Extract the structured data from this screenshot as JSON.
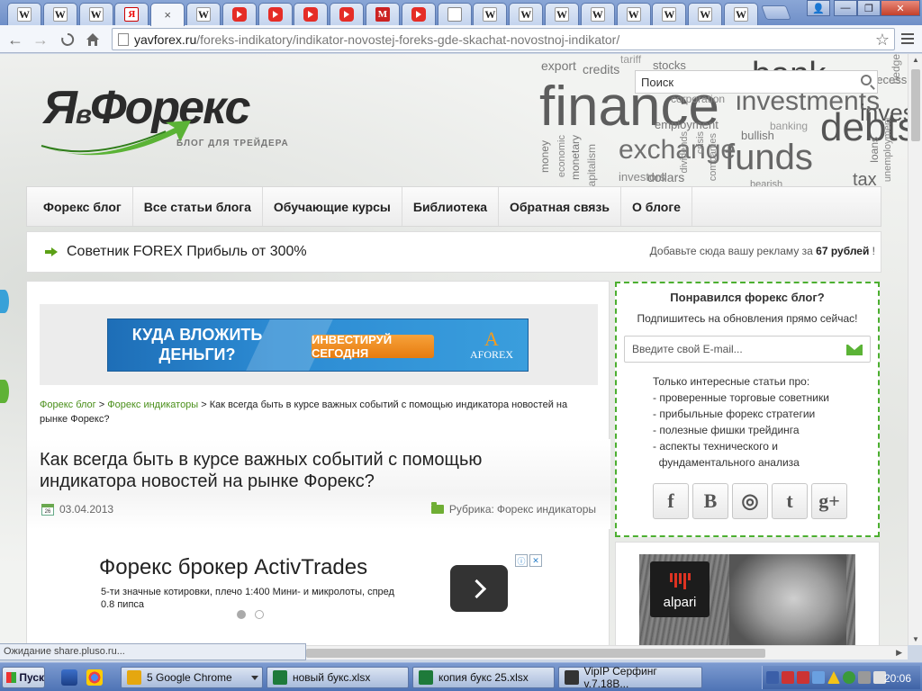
{
  "browser": {
    "tabs": [
      {
        "icon": "wikipedia-icon",
        "glyph": "W",
        "kind": "w"
      },
      {
        "icon": "wikipedia-icon",
        "glyph": "W",
        "kind": "w"
      },
      {
        "icon": "wikipedia-icon",
        "glyph": "W",
        "kind": "w"
      },
      {
        "icon": "yandex-icon",
        "glyph": "Я",
        "kind": "ya"
      },
      {
        "icon": "close-icon",
        "glyph": "×",
        "kind": "active"
      },
      {
        "icon": "wikipedia-icon",
        "glyph": "W",
        "kind": "w"
      },
      {
        "icon": "youtube-icon",
        "glyph": "",
        "kind": "yt"
      },
      {
        "icon": "youtube-icon",
        "glyph": "",
        "kind": "yt"
      },
      {
        "icon": "youtube-icon",
        "glyph": "",
        "kind": "yt"
      },
      {
        "icon": "youtube-icon",
        "glyph": "",
        "kind": "yt"
      },
      {
        "icon": "m-site-icon",
        "glyph": "M",
        "kind": "m"
      },
      {
        "icon": "youtube-icon",
        "glyph": "",
        "kind": "yt"
      },
      {
        "icon": "document-icon",
        "glyph": "",
        "kind": "doc"
      },
      {
        "icon": "wikipedia-icon",
        "glyph": "W",
        "kind": "w"
      },
      {
        "icon": "wikipedia-icon",
        "glyph": "W",
        "kind": "w"
      },
      {
        "icon": "wikipedia-icon",
        "glyph": "W",
        "kind": "w"
      },
      {
        "icon": "wikipedia-icon",
        "glyph": "W",
        "kind": "w"
      },
      {
        "icon": "wikipedia-icon",
        "glyph": "W",
        "kind": "w"
      },
      {
        "icon": "wikipedia-icon",
        "glyph": "W",
        "kind": "w"
      },
      {
        "icon": "wikipedia-icon",
        "glyph": "W",
        "kind": "w"
      },
      {
        "icon": "wikipedia-icon",
        "glyph": "W",
        "kind": "w"
      }
    ],
    "url_host": "yavforex.ru",
    "url_path": "/foreks-indikatory/indikator-novostej-foreks-gde-skachat-novostnoj-indikator/",
    "status_text": "Ожидание share.pluso.ru..."
  },
  "site": {
    "logo_main": "ЯвФорекс",
    "logo_ya": "Я",
    "logo_v": "в",
    "logo_forex": "Форекс",
    "logo_tagline": "БЛОГ ДЛЯ ТРЕЙДЕРА",
    "search_placeholder": "Поиск",
    "word_cloud": [
      "finance",
      "investments",
      "debts",
      "funds",
      "exchange",
      "bank",
      "invest",
      "credits",
      "export",
      "stocks",
      "corporation",
      "employment",
      "banking",
      "bullish",
      "dollars",
      "investors",
      "monetary",
      "economic",
      "money",
      "recession",
      "loans",
      "crisis",
      "dividends",
      "companies",
      "tariff",
      "hedge",
      "unemployment",
      "tax",
      "bearish",
      "capitalism"
    ],
    "nav": [
      "Форекс блог",
      "Все статьи блога",
      "Обучающие курсы",
      "Библиотека",
      "Обратная связь",
      "О блоге"
    ],
    "promo_link": "Советник FOREX Прибыль от 300%",
    "ad_offer_prefix": "Добавьте сюда вашу рекламу за ",
    "ad_offer_price": "67 рублей",
    "ad_offer_suffix": " !"
  },
  "banner": {
    "headline": "КУДА ВЛОЖИТЬ ДЕНЬГИ?",
    "cta": "ИНВЕСТИРУЙ СЕГОДНЯ",
    "brand": "AFOREX",
    "brand_mark": "A"
  },
  "article": {
    "breadcrumb": [
      {
        "label": "Форекс блог",
        "link": true
      },
      {
        "label": "Форекс индикаторы",
        "link": true
      },
      {
        "label": "Как всегда быть в курсе важных событий с помощью индикатора новостей на рынке Форекс?",
        "link": false
      }
    ],
    "breadcrumb_sep": " > ",
    "title": "Как всегда быть в курсе важных событий с помощью индикатора новостей на рынке Форекс?",
    "date": "03.04.2013",
    "calendar_day": "26",
    "category_label": "Рубрика: ",
    "category": "Форекс индикаторы"
  },
  "google_ad": {
    "headline": "Форекс брокер ActivTrades",
    "description": "5-ти значные котировки, плечо 1:400 Мини- и микролоты, спред 0.8 пипса",
    "choices_info": "ⓘ",
    "choices_close": "✕"
  },
  "sidebar": {
    "title": "Понравился форекс блог?",
    "subtitle": "Подпишитесь на обновления прямо сейчас!",
    "email_placeholder": "Введите свой E-mail...",
    "bullets": [
      "Только интересные статьи про:",
      "- проверенные торговые советники",
      "- прибыльные форекс стратегии",
      "- полезные фишки трейдинга",
      "- аспекты технического и",
      "  фундаментального анализа"
    ],
    "socials": [
      {
        "name": "facebook-icon",
        "glyph": "f"
      },
      {
        "name": "vkontakte-icon",
        "glyph": "B"
      },
      {
        "name": "rss-icon",
        "glyph": "◎"
      },
      {
        "name": "twitter-icon",
        "glyph": "t"
      },
      {
        "name": "google-plus-icon",
        "glyph": "g+"
      }
    ],
    "alpari_brand": "alpari"
  },
  "taskbar": {
    "start": "Пуск",
    "buttons": [
      {
        "label": "5 Google Chrome",
        "icon": "chrome-icon",
        "color": "#e5a70f"
      },
      {
        "label": "новый букс.xlsx",
        "icon": "excel-icon",
        "color": "#1e7a3a"
      },
      {
        "label": "копия букс 25.xlsx",
        "icon": "excel-icon",
        "color": "#1e7a3a"
      },
      {
        "label": "VipIP Серфинг v.7.18В...",
        "icon": "app-icon",
        "color": "#333"
      }
    ],
    "clock": "20:06"
  },
  "colors": {
    "accent_green": "#4caf30",
    "link_green": "#4a8f1a",
    "banner_blue": "#2c8bd3",
    "cta_orange": "#e67b0f"
  }
}
